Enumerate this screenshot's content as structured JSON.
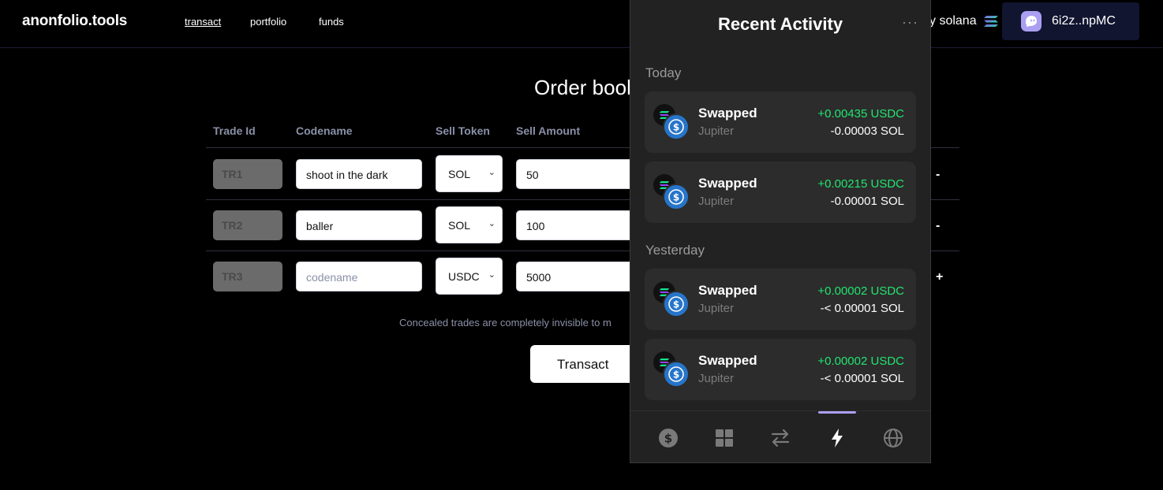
{
  "nav": {
    "logo": "anonfolio.tools",
    "links": [
      "transact",
      "portfolio",
      "funds"
    ],
    "powered_by": "y solana",
    "wallet_address": "6i2z..npMC"
  },
  "orderbook": {
    "title": "Order book",
    "headers": [
      "Trade Id",
      "Codename",
      "Sell Token",
      "Sell Amount"
    ],
    "rows": [
      {
        "id": "TR1",
        "codename": "shoot in the dark",
        "token": "SOL",
        "amount": "50",
        "action": "-"
      },
      {
        "id": "TR2",
        "codename": "baller",
        "token": "SOL",
        "amount": "100",
        "action": "-"
      },
      {
        "id": "TR3",
        "codename": "",
        "codename_placeholder": "codename",
        "token": "USDC",
        "amount": "5000",
        "action": "+"
      }
    ],
    "note": "Concealed trades are completely invisible to m",
    "submit_label": "Transact"
  },
  "activity": {
    "title": "Recent Activity",
    "more": "···",
    "sections": [
      {
        "label": "Today",
        "items": [
          {
            "title": "Swapped",
            "source": "Jupiter",
            "received": "+0.00435 USDC",
            "sent": "-0.00003 SOL"
          },
          {
            "title": "Swapped",
            "source": "Jupiter",
            "received": "+0.00215 USDC",
            "sent": "-0.00001 SOL"
          }
        ]
      },
      {
        "label": "Yesterday",
        "items": [
          {
            "title": "Swapped",
            "source": "Jupiter",
            "received": "+0.00002 USDC",
            "sent": "-< 0.00001 SOL"
          },
          {
            "title": "Swapped",
            "source": "Jupiter",
            "received": "+0.00002 USDC",
            "sent": "-< 0.00001 SOL"
          }
        ]
      }
    ],
    "bottom_nav": [
      "dollar-icon",
      "grid-icon",
      "swap-icon",
      "lightning-icon",
      "globe-icon"
    ],
    "active_tab": "lightning-icon"
  },
  "colors": {
    "background": "#000000",
    "panel": "#222222",
    "positive": "#21e56f",
    "phantom_accent": "#ab9ff2",
    "usdc": "#2775ca"
  }
}
